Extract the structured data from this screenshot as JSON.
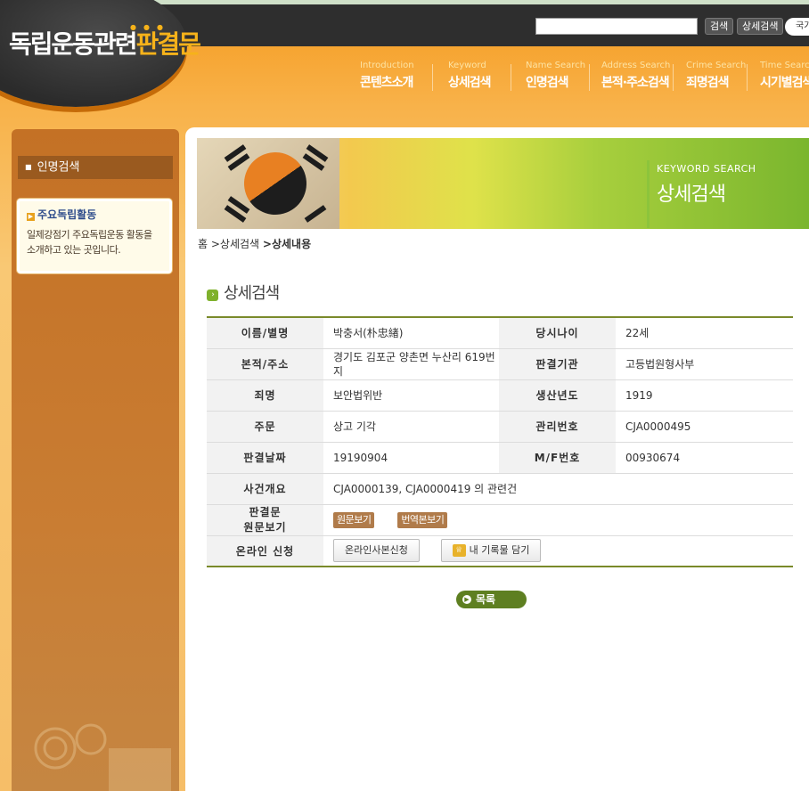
{
  "header": {
    "logo_main": "독립운동관련",
    "logo_accent": "판결문",
    "search_value": "",
    "search_button": "검색",
    "advanced_search_button": "상세검색",
    "lang_button": "국가"
  },
  "gnb": [
    {
      "en": "Introduction",
      "ko": "콘텐츠소개"
    },
    {
      "en": "Keyword",
      "ko": "상세검색"
    },
    {
      "en": "Name Search",
      "ko": "인명검색"
    },
    {
      "en": "Address Search",
      "ko": "본적·주소검색"
    },
    {
      "en": "Crime Search",
      "ko": "죄명검색"
    },
    {
      "en": "Time Search",
      "ko": "시기별검색"
    }
  ],
  "sidebar": {
    "menu_item": "인명검색",
    "box_title": "주요독립활동",
    "box_text": "일제강점기 주요독립운동 활동을 소개하고 있는 곳입니다."
  },
  "banner": {
    "en": "KEYWORD SEARCH",
    "ko": "상세검색"
  },
  "breadcrumb": {
    "home": "홈",
    "level1": ">상세검색",
    "current": ">상세내용"
  },
  "section_title": "상세검색",
  "detail": {
    "name_label": "이름/별명",
    "name_value": "박충서(朴忠緖)",
    "age_label": "당시나이",
    "age_value": "22세",
    "address_label": "본적/주소",
    "address_value": "경기도 김포군 양촌면 누산리 619번지",
    "court_label": "판결기관",
    "court_value": "고등법원형사부",
    "crime_label": "죄명",
    "crime_value": "보안법위반",
    "birth_label": "생산년도",
    "birth_value": "1919",
    "order_label": "주문",
    "order_value": "상고 기각",
    "manage_label": "관리번호",
    "manage_value": "CJA0000495",
    "date_label": "판결날짜",
    "date_value": "19190904",
    "mf_label": "M/F번호",
    "mf_value": "00930674",
    "summary_label": "사건개요",
    "summary_value": "CJA0000139, CJA0000419 의 관련건",
    "original_label_1": "판결문",
    "original_label_2": "원문보기",
    "original_button": "원문보기",
    "translation_button": "번역본보기",
    "online_label": "온라인 신청",
    "copy_request_button": "온라인사본신청",
    "my_records_button": "내 기록물 담기"
  },
  "list_button": "목록",
  "colors": {
    "accent_orange": "#f59a1e",
    "accent_green": "#7a8a2a",
    "button_green": "#5e7f21",
    "sidebar_brown": "#c97a2f"
  }
}
